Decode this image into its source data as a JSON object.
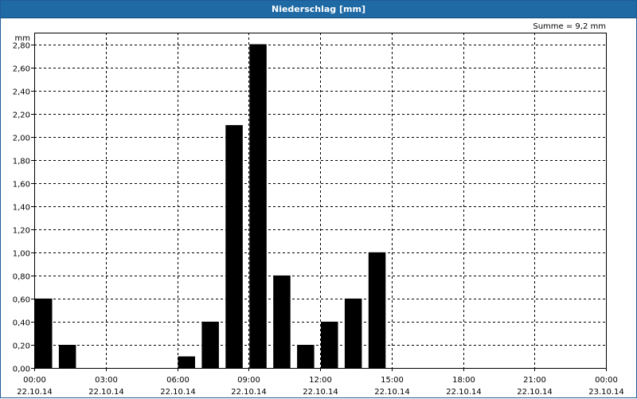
{
  "window": {
    "title": "Niederschlag [mm]"
  },
  "chart_data": {
    "type": "bar",
    "title": "Niederschlag [mm]",
    "ylabel": "mm",
    "annotation": "Summe = 9,2 mm",
    "ylim": [
      0,
      2.9
    ],
    "y_ticks": [
      {
        "value": 0.0,
        "label": "0,00"
      },
      {
        "value": 0.2,
        "label": "0,20"
      },
      {
        "value": 0.4,
        "label": "0,40"
      },
      {
        "value": 0.6,
        "label": "0,60"
      },
      {
        "value": 0.8,
        "label": "0,80"
      },
      {
        "value": 1.0,
        "label": "1,00"
      },
      {
        "value": 1.2,
        "label": "1,20"
      },
      {
        "value": 1.4,
        "label": "1,40"
      },
      {
        "value": 1.6,
        "label": "1,60"
      },
      {
        "value": 1.8,
        "label": "1,80"
      },
      {
        "value": 2.0,
        "label": "2,00"
      },
      {
        "value": 2.2,
        "label": "2,20"
      },
      {
        "value": 2.4,
        "label": "2,40"
      },
      {
        "value": 2.6,
        "label": "2,60"
      },
      {
        "value": 2.8,
        "label": "2,80"
      }
    ],
    "x_ticks": [
      {
        "time": "00:00",
        "date": "22.10.14"
      },
      {
        "time": "03:00",
        "date": "22.10.14"
      },
      {
        "time": "06:00",
        "date": "22.10.14"
      },
      {
        "time": "09:00",
        "date": "22.10.14"
      },
      {
        "time": "12:00",
        "date": "22.10.14"
      },
      {
        "time": "15:00",
        "date": "22.10.14"
      },
      {
        "time": "18:00",
        "date": "22.10.14"
      },
      {
        "time": "21:00",
        "date": "22.10.14"
      },
      {
        "time": "00:00",
        "date": "23.10.14"
      }
    ],
    "bars": [
      {
        "time": "00:00",
        "value": 0.6
      },
      {
        "time": "01:00",
        "value": 0.2
      },
      {
        "time": "02:00",
        "value": 0.0
      },
      {
        "time": "03:00",
        "value": 0.0
      },
      {
        "time": "04:00",
        "value": 0.0
      },
      {
        "time": "05:00",
        "value": 0.0
      },
      {
        "time": "06:00",
        "value": 0.1
      },
      {
        "time": "07:00",
        "value": 0.4
      },
      {
        "time": "08:00",
        "value": 2.1
      },
      {
        "time": "09:00",
        "value": 2.8
      },
      {
        "time": "10:00",
        "value": 0.8
      },
      {
        "time": "11:00",
        "value": 0.2
      },
      {
        "time": "12:00",
        "value": 0.4
      },
      {
        "time": "13:00",
        "value": 0.6
      },
      {
        "time": "14:00",
        "value": 1.0
      }
    ],
    "grid": true,
    "bar_color": "#000000"
  }
}
